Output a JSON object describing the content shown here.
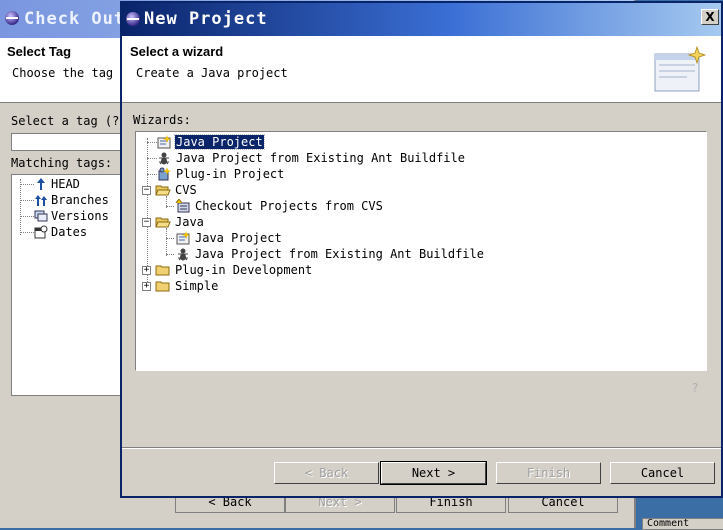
{
  "background_dialog": {
    "title": "Check Out",
    "header_title": "Select Tag",
    "header_desc": "Choose the tag",
    "select_tag_label": "Select a tag (?",
    "matching_tags_label": "Matching tags:",
    "tree": [
      {
        "label": "HEAD",
        "icon": "head-tag-icon"
      },
      {
        "label": "Branches",
        "icon": "branches-icon"
      },
      {
        "label": "Versions",
        "icon": "versions-icon"
      },
      {
        "label": "Dates",
        "icon": "dates-icon"
      }
    ],
    "buttons": {
      "back": "< Back",
      "next": "Next >",
      "finish": "Finish",
      "cancel": "Cancel"
    },
    "side_item": "Comment"
  },
  "dialog": {
    "title": "New Project",
    "close_symbol": "X",
    "header_title": "Select a wizard",
    "header_desc": "Create a Java project",
    "wizards_label": "Wizards:",
    "tree": [
      {
        "label": "Java Project",
        "icon": "java-project-icon",
        "selected": true
      },
      {
        "label": "Java Project from Existing Ant Buildfile",
        "icon": "ant-icon"
      },
      {
        "label": "Plug-in Project",
        "icon": "plugin-project-icon"
      },
      {
        "label": "CVS",
        "icon": "folder-open-icon",
        "expanded": true
      },
      {
        "label": "Checkout Projects from CVS",
        "icon": "cvs-checkout-icon"
      },
      {
        "label": "Java",
        "icon": "folder-open-icon",
        "expanded": true
      },
      {
        "label": "Java Project",
        "icon": "java-project-icon"
      },
      {
        "label": "Java Project from Existing Ant Buildfile",
        "icon": "ant-icon"
      },
      {
        "label": "Plug-in Development",
        "icon": "folder-closed-icon",
        "expanded": false
      },
      {
        "label": "Simple",
        "icon": "folder-closed-icon",
        "expanded": false
      }
    ],
    "buttons": {
      "back": "< Back",
      "next": "Next >",
      "finish": "Finish",
      "cancel": "Cancel"
    },
    "help_symbol": "?"
  },
  "colors": {
    "title_active": "#0a246a",
    "selection": "#0a246a",
    "face": "#d4d0c8"
  }
}
